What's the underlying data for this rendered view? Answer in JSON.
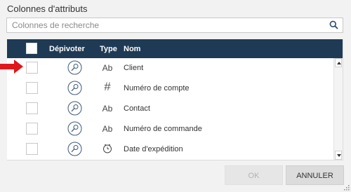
{
  "dialog": {
    "title": "Colonnes d'attributs"
  },
  "search": {
    "placeholder": "Colonnes de recherche",
    "value": ""
  },
  "grid": {
    "columns": {
      "pivot": "Dépivoter",
      "type": "Type",
      "name": "Nom"
    },
    "rows": [
      {
        "type": "Ab",
        "type_icon": "text-type",
        "name": "Client",
        "checked": false
      },
      {
        "type": "#",
        "type_icon": "number-type",
        "name": "Numéro de compte",
        "checked": false
      },
      {
        "type": "Ab",
        "type_icon": "text-type",
        "name": "Contact",
        "checked": false
      },
      {
        "type": "Ab",
        "type_icon": "text-type",
        "name": "Numéro de commande",
        "checked": false
      },
      {
        "type": "",
        "type_icon": "clock-date-type",
        "name": "Date d'expédition",
        "checked": false
      }
    ]
  },
  "buttons": {
    "ok": "OK",
    "cancel": "ANNULER"
  },
  "colors": {
    "header_bg": "#1f3a54",
    "pivot_icon": "#3d5878",
    "arrow": "#e0181b"
  }
}
